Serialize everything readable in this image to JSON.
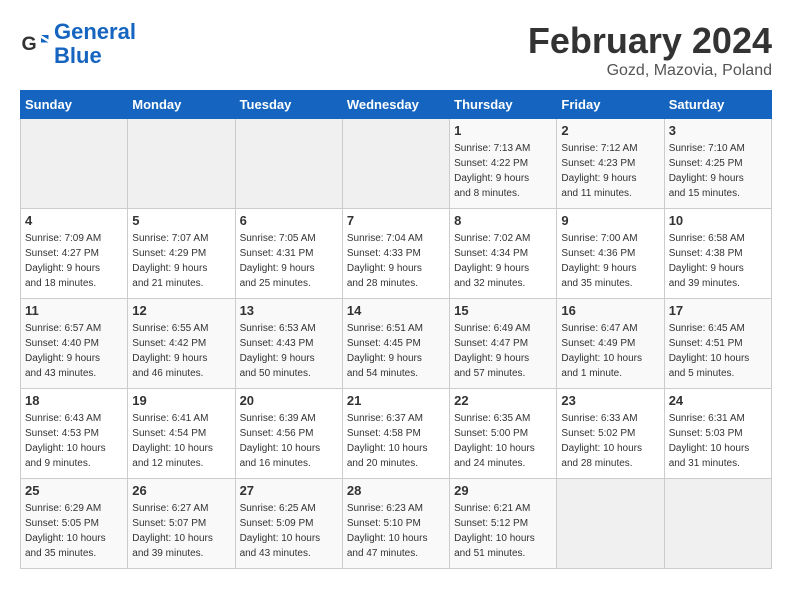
{
  "logo": {
    "line1": "General",
    "line2": "Blue"
  },
  "title": "February 2024",
  "subtitle": "Gozd, Mazovia, Poland",
  "days_of_week": [
    "Sunday",
    "Monday",
    "Tuesday",
    "Wednesday",
    "Thursday",
    "Friday",
    "Saturday"
  ],
  "weeks": [
    [
      {
        "day": "",
        "info": ""
      },
      {
        "day": "",
        "info": ""
      },
      {
        "day": "",
        "info": ""
      },
      {
        "day": "",
        "info": ""
      },
      {
        "day": "1",
        "info": "Sunrise: 7:13 AM\nSunset: 4:22 PM\nDaylight: 9 hours\nand 8 minutes."
      },
      {
        "day": "2",
        "info": "Sunrise: 7:12 AM\nSunset: 4:23 PM\nDaylight: 9 hours\nand 11 minutes."
      },
      {
        "day": "3",
        "info": "Sunrise: 7:10 AM\nSunset: 4:25 PM\nDaylight: 9 hours\nand 15 minutes."
      }
    ],
    [
      {
        "day": "4",
        "info": "Sunrise: 7:09 AM\nSunset: 4:27 PM\nDaylight: 9 hours\nand 18 minutes."
      },
      {
        "day": "5",
        "info": "Sunrise: 7:07 AM\nSunset: 4:29 PM\nDaylight: 9 hours\nand 21 minutes."
      },
      {
        "day": "6",
        "info": "Sunrise: 7:05 AM\nSunset: 4:31 PM\nDaylight: 9 hours\nand 25 minutes."
      },
      {
        "day": "7",
        "info": "Sunrise: 7:04 AM\nSunset: 4:33 PM\nDaylight: 9 hours\nand 28 minutes."
      },
      {
        "day": "8",
        "info": "Sunrise: 7:02 AM\nSunset: 4:34 PM\nDaylight: 9 hours\nand 32 minutes."
      },
      {
        "day": "9",
        "info": "Sunrise: 7:00 AM\nSunset: 4:36 PM\nDaylight: 9 hours\nand 35 minutes."
      },
      {
        "day": "10",
        "info": "Sunrise: 6:58 AM\nSunset: 4:38 PM\nDaylight: 9 hours\nand 39 minutes."
      }
    ],
    [
      {
        "day": "11",
        "info": "Sunrise: 6:57 AM\nSunset: 4:40 PM\nDaylight: 9 hours\nand 43 minutes."
      },
      {
        "day": "12",
        "info": "Sunrise: 6:55 AM\nSunset: 4:42 PM\nDaylight: 9 hours\nand 46 minutes."
      },
      {
        "day": "13",
        "info": "Sunrise: 6:53 AM\nSunset: 4:43 PM\nDaylight: 9 hours\nand 50 minutes."
      },
      {
        "day": "14",
        "info": "Sunrise: 6:51 AM\nSunset: 4:45 PM\nDaylight: 9 hours\nand 54 minutes."
      },
      {
        "day": "15",
        "info": "Sunrise: 6:49 AM\nSunset: 4:47 PM\nDaylight: 9 hours\nand 57 minutes."
      },
      {
        "day": "16",
        "info": "Sunrise: 6:47 AM\nSunset: 4:49 PM\nDaylight: 10 hours\nand 1 minute."
      },
      {
        "day": "17",
        "info": "Sunrise: 6:45 AM\nSunset: 4:51 PM\nDaylight: 10 hours\nand 5 minutes."
      }
    ],
    [
      {
        "day": "18",
        "info": "Sunrise: 6:43 AM\nSunset: 4:53 PM\nDaylight: 10 hours\nand 9 minutes."
      },
      {
        "day": "19",
        "info": "Sunrise: 6:41 AM\nSunset: 4:54 PM\nDaylight: 10 hours\nand 12 minutes."
      },
      {
        "day": "20",
        "info": "Sunrise: 6:39 AM\nSunset: 4:56 PM\nDaylight: 10 hours\nand 16 minutes."
      },
      {
        "day": "21",
        "info": "Sunrise: 6:37 AM\nSunset: 4:58 PM\nDaylight: 10 hours\nand 20 minutes."
      },
      {
        "day": "22",
        "info": "Sunrise: 6:35 AM\nSunset: 5:00 PM\nDaylight: 10 hours\nand 24 minutes."
      },
      {
        "day": "23",
        "info": "Sunrise: 6:33 AM\nSunset: 5:02 PM\nDaylight: 10 hours\nand 28 minutes."
      },
      {
        "day": "24",
        "info": "Sunrise: 6:31 AM\nSunset: 5:03 PM\nDaylight: 10 hours\nand 31 minutes."
      }
    ],
    [
      {
        "day": "25",
        "info": "Sunrise: 6:29 AM\nSunset: 5:05 PM\nDaylight: 10 hours\nand 35 minutes."
      },
      {
        "day": "26",
        "info": "Sunrise: 6:27 AM\nSunset: 5:07 PM\nDaylight: 10 hours\nand 39 minutes."
      },
      {
        "day": "27",
        "info": "Sunrise: 6:25 AM\nSunset: 5:09 PM\nDaylight: 10 hours\nand 43 minutes."
      },
      {
        "day": "28",
        "info": "Sunrise: 6:23 AM\nSunset: 5:10 PM\nDaylight: 10 hours\nand 47 minutes."
      },
      {
        "day": "29",
        "info": "Sunrise: 6:21 AM\nSunset: 5:12 PM\nDaylight: 10 hours\nand 51 minutes."
      },
      {
        "day": "",
        "info": ""
      },
      {
        "day": "",
        "info": ""
      }
    ]
  ]
}
